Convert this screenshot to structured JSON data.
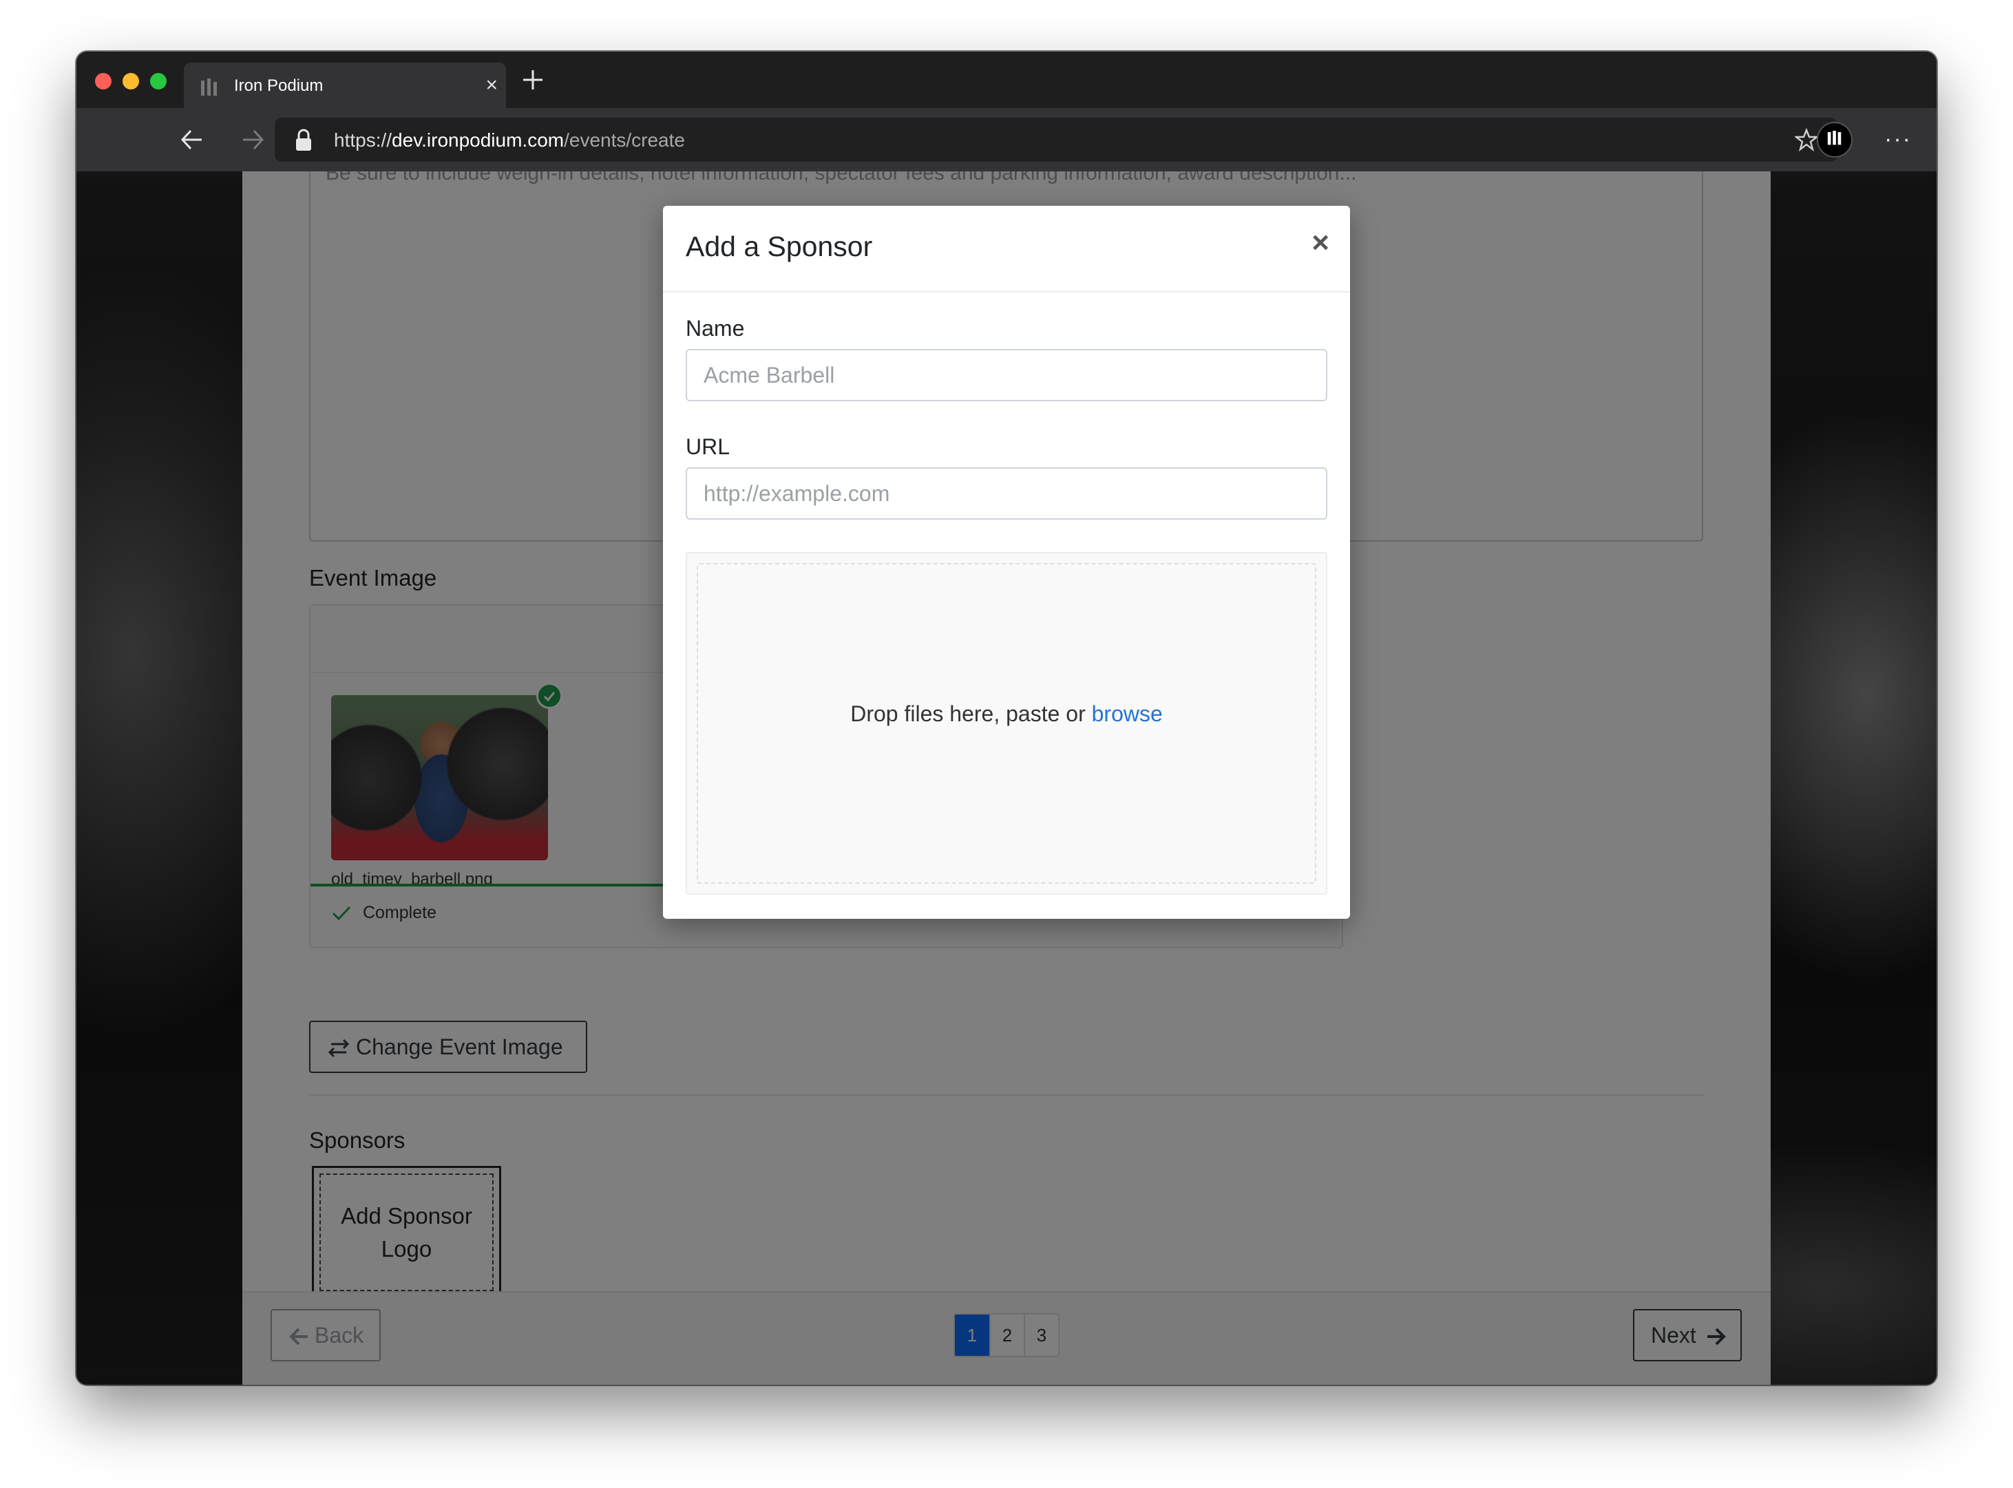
{
  "browser": {
    "tab_title": "Iron Podium",
    "url_scheme": "https://",
    "url_host": "dev.ironpodium.com",
    "url_path": "/events/create",
    "icons": {
      "back": "arrow-left-icon",
      "forward": "arrow-right-icon",
      "reload": "reload-icon",
      "lock": "lock-icon",
      "star": "star-icon",
      "menu": "more-dots-icon"
    }
  },
  "page": {
    "description_hint": "Be sure to include weigh-in details, hotel information, spectator fees and parking information, award description...",
    "event_image_label": "Event Image",
    "file_name": "old_timey_barbell.png",
    "upload_status": "Complete",
    "change_image_button": "Change Event Image",
    "sponsors_label": "Sponsors",
    "add_sponsor_logo": "Add Sponsor Logo",
    "back_button": "Back",
    "next_button": "Next",
    "pages": [
      "1",
      "2",
      "3"
    ],
    "active_page": "1"
  },
  "modal": {
    "title": "Add a Sponsor",
    "close": "×",
    "name_label": "Name",
    "name_placeholder": "Acme Barbell",
    "url_label": "URL",
    "url_placeholder": "http://example.com",
    "drop_text": "Drop files here, paste or",
    "browse_link": "browse"
  },
  "colors": {
    "primary": "#0d6efd",
    "success": "#1e9b4b",
    "link": "#2275d7"
  }
}
